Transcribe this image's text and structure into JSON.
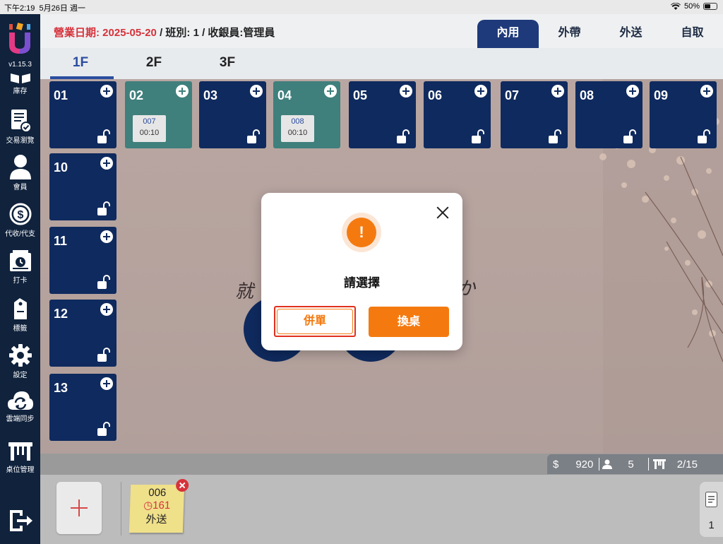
{
  "status_bar": {
    "time": "下午2:19",
    "date": "5月26日 週一",
    "battery": "50%"
  },
  "sidebar": {
    "version": "v1.15.3",
    "items": [
      {
        "label": "庫存",
        "icon": "inventory-icon"
      },
      {
        "label": "交易瀏覽",
        "icon": "transactions-icon"
      },
      {
        "label": "會員",
        "icon": "member-icon"
      },
      {
        "label": "代收/代支",
        "icon": "cash-collect-icon"
      },
      {
        "label": "打卡",
        "icon": "clock-in-icon"
      },
      {
        "label": "標籤",
        "icon": "tag-icon"
      },
      {
        "label": "設定",
        "icon": "gear-icon"
      },
      {
        "label": "雲端同步",
        "icon": "cloud-sync-icon"
      },
      {
        "label": "桌位管理",
        "icon": "table-manage-icon"
      }
    ]
  },
  "header": {
    "business_date_label": "營業日期: 2025-05-20",
    "shift_cashier": " / 班別: 1 / 收銀員:管理員",
    "modes": [
      "內用",
      "外帶",
      "外送",
      "自取"
    ]
  },
  "floors": [
    "1F",
    "2F",
    "3F"
  ],
  "tables": [
    {
      "num": "01",
      "occupied": false
    },
    {
      "num": "02",
      "occupied": true,
      "order": "007",
      "time": "00:10"
    },
    {
      "num": "03",
      "occupied": false
    },
    {
      "num": "04",
      "occupied": true,
      "order": "008",
      "time": "00:10"
    },
    {
      "num": "05",
      "occupied": false
    },
    {
      "num": "06",
      "occupied": false
    },
    {
      "num": "07",
      "occupied": false
    },
    {
      "num": "08",
      "occupied": false
    },
    {
      "num": "09",
      "occupied": false
    },
    {
      "num": "10",
      "occupied": false
    },
    {
      "num": "11",
      "occupied": false
    },
    {
      "num": "12",
      "occupied": false
    },
    {
      "num": "13",
      "occupied": false
    }
  ],
  "summary": {
    "amount": "920",
    "guests": "5",
    "tables": "2/15",
    "currency_symbol": "$"
  },
  "pending_order": {
    "number": "006",
    "timer": "161",
    "type": "外送"
  },
  "notes_count": "1",
  "dialog": {
    "title": "請選擇",
    "merge_label": "併單",
    "swap_label": "換桌",
    "warning_symbol": "!"
  },
  "colors": {
    "navy": "#0f2a5e",
    "occupied": "#3f7f7c",
    "accent": "#f47a10",
    "highlight": "#e0301e"
  }
}
